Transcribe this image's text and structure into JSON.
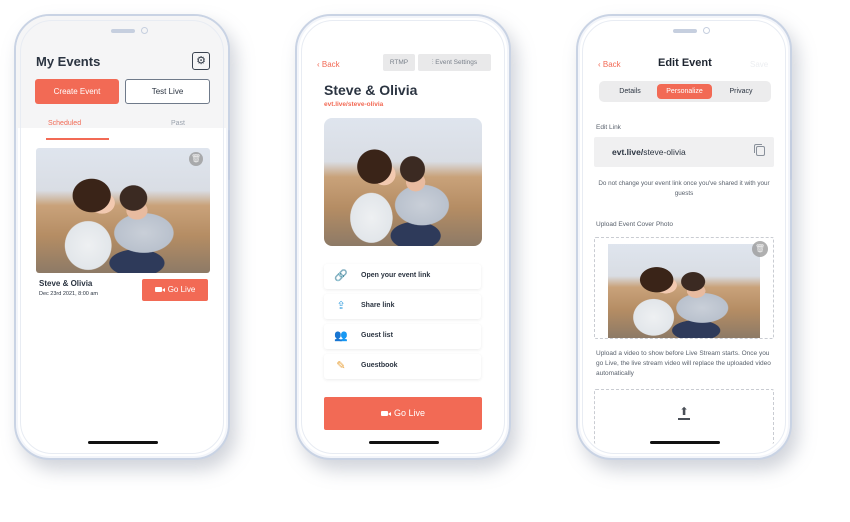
{
  "colors": {
    "accent": "#f26a55",
    "text_dark": "#2b3441",
    "muted": "#9aa2ad",
    "segment_bg": "#ececed"
  },
  "phone1": {
    "title": "My Events",
    "settings_icon": "gear-icon",
    "create_event_label": "Create Event",
    "test_live_label": "Test Live",
    "tabs": [
      {
        "label": "Scheduled",
        "active": true
      },
      {
        "label": "Past",
        "active": false
      }
    ],
    "event": {
      "name": "Steve & Olivia",
      "date": "Dec 23rd 2021, 8:00 am",
      "go_live_label": "Go Live",
      "delete_icon": "trash-icon",
      "photo": "couple-laughing-in-field-photo"
    }
  },
  "phone2": {
    "back_label": "Back",
    "rtmp_label": "RTMP",
    "event_settings_label": "Event Settings",
    "title": "Steve & Olivia",
    "link": "evt.live/steve-olivia",
    "photo": "couple-laughing-in-field-photo",
    "actions": [
      {
        "label": "Open your event link",
        "icon": "link-icon"
      },
      {
        "label": "Share link",
        "icon": "share-icon"
      },
      {
        "label": "Guest list",
        "icon": "guests-icon"
      },
      {
        "label": "Guestbook",
        "icon": "guestbook-icon"
      }
    ],
    "go_live_label": "Go Live"
  },
  "phone3": {
    "back_label": "Back",
    "title": "Edit Event",
    "save_label": "Save",
    "segments": [
      {
        "label": "Details",
        "active": false
      },
      {
        "label": "Personalize",
        "active": true
      },
      {
        "label": "Privacy",
        "active": false
      }
    ],
    "edit_link_label": "Edit Link",
    "link_prefix": "evt.live/",
    "link_slug": "steve-olivia",
    "link_note": "Do not change your event link once you've shared it with your guests",
    "cover_photo_label": "Upload Event Cover Photo",
    "upload_video_note": "Upload a video to show before Live Stream starts. Once you go Live, the live stream video will replace the uploaded video automatically"
  }
}
